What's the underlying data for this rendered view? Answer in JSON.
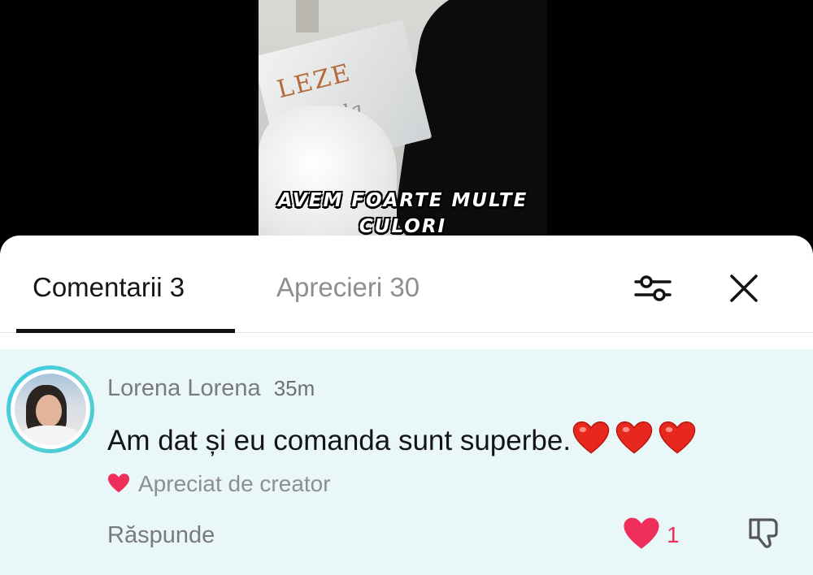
{
  "video": {
    "caption_line1": "AVEM FOARTE MULTE",
    "caption_line2": "CULORI",
    "sign_text": "LEZE",
    "sign_sub": "rada"
  },
  "tabs": [
    {
      "label": "Comentarii 3",
      "active": true
    },
    {
      "label": "Aprecieri 30",
      "active": false
    }
  ],
  "icons": {
    "filter": "sliders-icon",
    "close": "close-icon",
    "like": "heart-icon",
    "dislike": "thumbs-down-icon"
  },
  "comment": {
    "author": "Lorena Lorena",
    "time": "35m",
    "text": "Am dat și eu comanda sunt superbe.",
    "emoji": [
      "❤️",
      "❤️",
      "❤️"
    ],
    "creator_badge": "Apreciat de creator",
    "reply_label": "Răspunde",
    "like_count": "1"
  },
  "colors": {
    "accent": "#ef2f5b",
    "comment_bg": "#eaf7f9",
    "avatar_ring": "#41c8d8"
  }
}
